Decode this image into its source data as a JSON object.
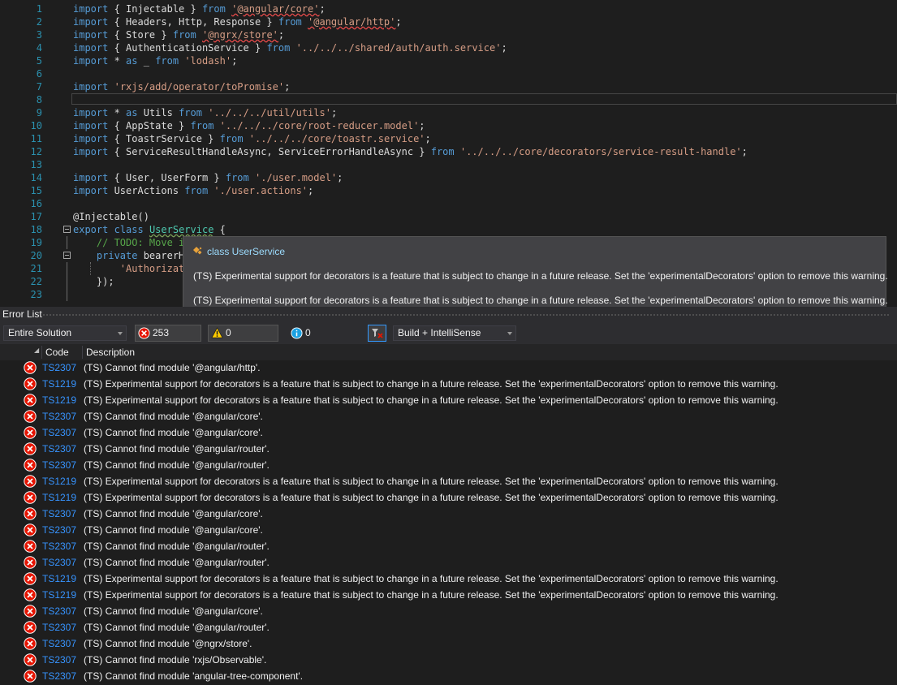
{
  "editor": {
    "lines": [
      {
        "n": "1",
        "parts": [
          [
            "kw",
            "import"
          ],
          [
            "pl",
            " { Injectable } "
          ],
          [
            "kw",
            "from"
          ],
          [
            "pl",
            " "
          ],
          [
            "str sq",
            "'@angular/core'"
          ],
          [
            "pl",
            ";"
          ]
        ]
      },
      {
        "n": "2",
        "parts": [
          [
            "kw",
            "import"
          ],
          [
            "pl",
            " { Headers, Http, Response } "
          ],
          [
            "kw",
            "from"
          ],
          [
            "pl",
            " "
          ],
          [
            "str sq",
            "'@angular/http'"
          ],
          [
            "pl",
            ";"
          ]
        ]
      },
      {
        "n": "3",
        "parts": [
          [
            "kw",
            "import"
          ],
          [
            "pl",
            " { Store } "
          ],
          [
            "kw",
            "from"
          ],
          [
            "pl",
            " "
          ],
          [
            "str sq",
            "'@ngrx/store'"
          ],
          [
            "pl",
            ";"
          ]
        ]
      },
      {
        "n": "4",
        "parts": [
          [
            "kw",
            "import"
          ],
          [
            "pl",
            " { AuthenticationService } "
          ],
          [
            "kw",
            "from"
          ],
          [
            "pl",
            " "
          ],
          [
            "str",
            "'../../../shared/auth/auth.service'"
          ],
          [
            "pl",
            ";"
          ]
        ]
      },
      {
        "n": "5",
        "parts": [
          [
            "kw",
            "import"
          ],
          [
            "pl",
            " * "
          ],
          [
            "kw",
            "as"
          ],
          [
            "pl",
            " _ "
          ],
          [
            "kw",
            "from"
          ],
          [
            "pl",
            " "
          ],
          [
            "str",
            "'lodash'"
          ],
          [
            "pl",
            ";"
          ]
        ]
      },
      {
        "n": "6",
        "parts": []
      },
      {
        "n": "7",
        "parts": [
          [
            "kw",
            "import"
          ],
          [
            "pl",
            " "
          ],
          [
            "str",
            "'rxjs/add/operator/toPromise'"
          ],
          [
            "pl",
            ";"
          ]
        ]
      },
      {
        "n": "8",
        "parts": [],
        "current": true
      },
      {
        "n": "9",
        "parts": [
          [
            "kw",
            "import"
          ],
          [
            "pl",
            " * "
          ],
          [
            "kw",
            "as"
          ],
          [
            "pl",
            " Utils "
          ],
          [
            "kw",
            "from"
          ],
          [
            "pl",
            " "
          ],
          [
            "str",
            "'../../../util/utils'"
          ],
          [
            "pl",
            ";"
          ]
        ]
      },
      {
        "n": "10",
        "parts": [
          [
            "kw",
            "import"
          ],
          [
            "pl",
            " { AppState } "
          ],
          [
            "kw",
            "from"
          ],
          [
            "pl",
            " "
          ],
          [
            "str",
            "'../../../core/root-reducer.model'"
          ],
          [
            "pl",
            ";"
          ]
        ]
      },
      {
        "n": "11",
        "parts": [
          [
            "kw",
            "import"
          ],
          [
            "pl",
            " { ToastrService } "
          ],
          [
            "kw",
            "from"
          ],
          [
            "pl",
            " "
          ],
          [
            "str",
            "'../../../core/toastr.service'"
          ],
          [
            "pl",
            ";"
          ]
        ]
      },
      {
        "n": "12",
        "parts": [
          [
            "kw",
            "import"
          ],
          [
            "pl",
            " { ServiceResultHandleAsync, ServiceErrorHandleAsync } "
          ],
          [
            "kw",
            "from"
          ],
          [
            "pl",
            " "
          ],
          [
            "str",
            "'../../../core/decorators/service-result-handle'"
          ],
          [
            "pl",
            ";"
          ]
        ]
      },
      {
        "n": "13",
        "parts": []
      },
      {
        "n": "14",
        "parts": [
          [
            "kw",
            "import"
          ],
          [
            "pl",
            " { User, UserForm } "
          ],
          [
            "kw",
            "from"
          ],
          [
            "pl",
            " "
          ],
          [
            "str",
            "'./user.model'"
          ],
          [
            "pl",
            ";"
          ]
        ]
      },
      {
        "n": "15",
        "parts": [
          [
            "kw",
            "import"
          ],
          [
            "pl",
            " UserActions "
          ],
          [
            "kw",
            "from"
          ],
          [
            "pl",
            " "
          ],
          [
            "str",
            "'./user.actions'"
          ],
          [
            "pl",
            ";"
          ]
        ]
      },
      {
        "n": "16",
        "parts": []
      },
      {
        "n": "17",
        "parts": [
          [
            "pl",
            "@Injectable()"
          ]
        ]
      },
      {
        "n": "18",
        "fold": true,
        "parts": [
          [
            "kw",
            "export"
          ],
          [
            "pl",
            " "
          ],
          [
            "kw",
            "class"
          ],
          [
            "pl",
            " "
          ],
          [
            "ty sq2",
            "UserService"
          ],
          [
            "pl",
            " {"
          ]
        ]
      },
      {
        "n": "19",
        "guide": true,
        "parts": [
          [
            "pl",
            "    "
          ],
          [
            "cm",
            "// TODO: Move i"
          ]
        ]
      },
      {
        "n": "20",
        "fold": true,
        "parts": [
          [
            "pl",
            "    "
          ],
          [
            "kw",
            "private"
          ],
          [
            "pl",
            " bearerH"
          ]
        ]
      },
      {
        "n": "21",
        "guide": true,
        "guide2": true,
        "parts": [
          [
            "pl",
            "        "
          ],
          [
            "str",
            "'Authorizat"
          ]
        ]
      },
      {
        "n": "22",
        "guide": true,
        "parts": [
          [
            "pl",
            "    });"
          ]
        ]
      },
      {
        "n": "23",
        "guide": true,
        "parts": []
      }
    ]
  },
  "tooltip": {
    "header": "class UserService",
    "lines": [
      "(TS) Experimental support for decorators is a feature that is subject to change in a future release. Set the 'experimentalDecorators' option to remove this warning.",
      "(TS) Experimental support for decorators is a feature that is subject to change in a future release. Set the 'experimentalDecorators' option to remove this warning."
    ]
  },
  "error_list": {
    "title": "Error List",
    "scope": "Entire Solution",
    "errors_label": "253 Errors",
    "warnings_label": "0 Warnings",
    "messages_label": "0 Messages",
    "build_filter": "Build + IntelliSense",
    "columns": {
      "code": "Code",
      "description": "Description"
    },
    "rows": [
      {
        "code": "TS2307",
        "desc": "(TS) Cannot find module '@angular/http'."
      },
      {
        "code": "TS1219",
        "desc": "(TS) Experimental support for decorators is a feature that is subject to change in a future release. Set the 'experimentalDecorators' option to remove this warning."
      },
      {
        "code": "TS1219",
        "desc": "(TS) Experimental support for decorators is a feature that is subject to change in a future release. Set the 'experimentalDecorators' option to remove this warning."
      },
      {
        "code": "TS2307",
        "desc": "(TS) Cannot find module '@angular/core'."
      },
      {
        "code": "TS2307",
        "desc": "(TS) Cannot find module '@angular/core'."
      },
      {
        "code": "TS2307",
        "desc": "(TS) Cannot find module '@angular/router'."
      },
      {
        "code": "TS2307",
        "desc": "(TS) Cannot find module '@angular/router'."
      },
      {
        "code": "TS1219",
        "desc": "(TS) Experimental support for decorators is a feature that is subject to change in a future release. Set the 'experimentalDecorators' option to remove this warning."
      },
      {
        "code": "TS1219",
        "desc": "(TS) Experimental support for decorators is a feature that is subject to change in a future release. Set the 'experimentalDecorators' option to remove this warning."
      },
      {
        "code": "TS2307",
        "desc": "(TS) Cannot find module '@angular/core'."
      },
      {
        "code": "TS2307",
        "desc": "(TS) Cannot find module '@angular/core'."
      },
      {
        "code": "TS2307",
        "desc": "(TS) Cannot find module '@angular/router'."
      },
      {
        "code": "TS2307",
        "desc": "(TS) Cannot find module '@angular/router'."
      },
      {
        "code": "TS1219",
        "desc": "(TS) Experimental support for decorators is a feature that is subject to change in a future release. Set the 'experimentalDecorators' option to remove this warning."
      },
      {
        "code": "TS1219",
        "desc": "(TS) Experimental support for decorators is a feature that is subject to change in a future release. Set the 'experimentalDecorators' option to remove this warning."
      },
      {
        "code": "TS2307",
        "desc": "(TS) Cannot find module '@angular/core'."
      },
      {
        "code": "TS2307",
        "desc": "(TS) Cannot find module '@angular/router'."
      },
      {
        "code": "TS2307",
        "desc": "(TS) Cannot find module '@ngrx/store'."
      },
      {
        "code": "TS2307",
        "desc": "(TS) Cannot find module 'rxjs/Observable'."
      },
      {
        "code": "TS2307",
        "desc": "(TS) Cannot find module 'angular-tree-component'."
      }
    ]
  },
  "icons": {
    "error": "error-circle-icon",
    "warning": "warning-triangle-icon",
    "info": "info-circle-icon",
    "class": "class-icon",
    "filter": "filter-icon"
  },
  "colors": {
    "error_red": "#e51400",
    "warning_yellow": "#ffcc00",
    "info_blue": "#1ba1e2",
    "link_blue": "#3794ff"
  }
}
